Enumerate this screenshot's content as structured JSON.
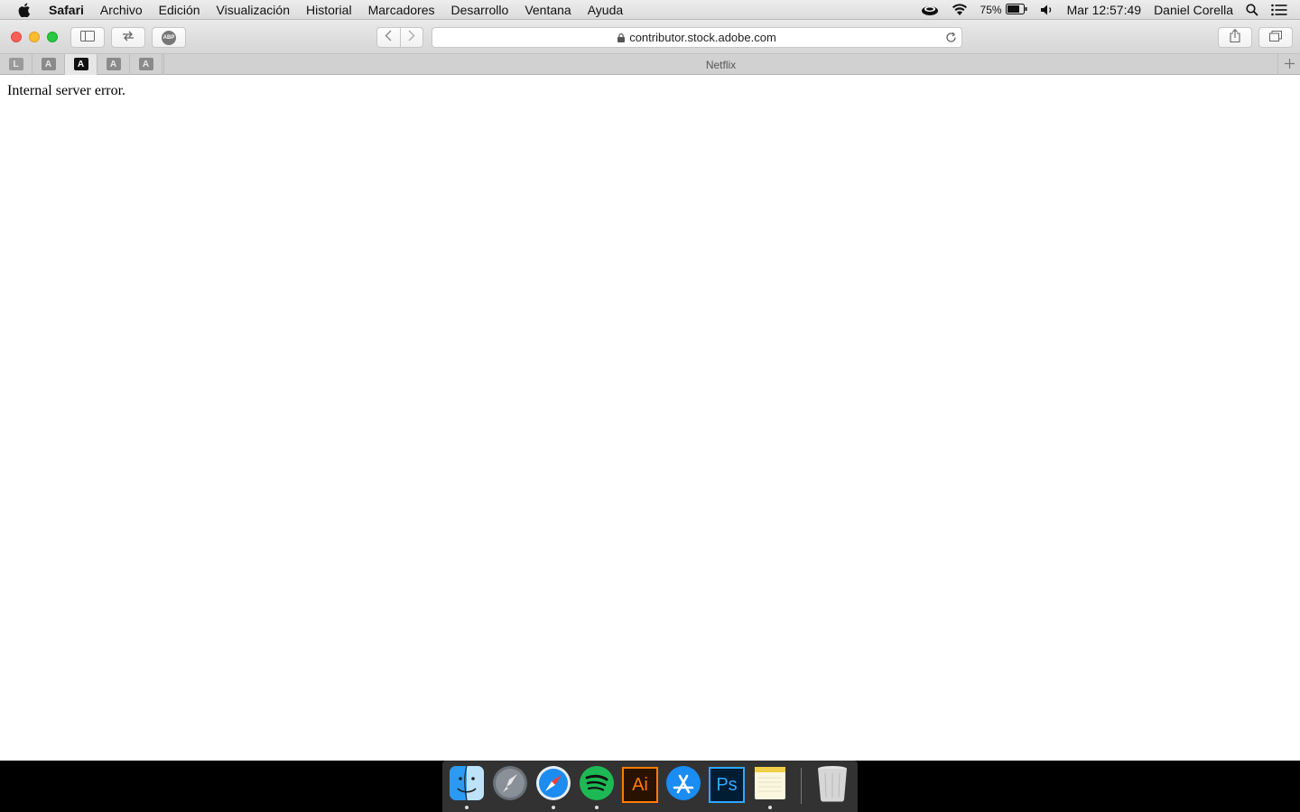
{
  "menubar": {
    "apple_icon": "apple-icon",
    "items": [
      "Safari",
      "Archivo",
      "Edición",
      "Visualización",
      "Historial",
      "Marcadores",
      "Desarrollo",
      "Ventana",
      "Ayuda"
    ],
    "status": {
      "battery_percent": "75%",
      "clock": "Mar 12:57:49",
      "user": "Daniel Corella"
    }
  },
  "toolbar": {
    "url": "contributor.stock.adobe.com",
    "adblock_label": "ABP"
  },
  "tabs": {
    "pinned": [
      {
        "letter": "L",
        "active": false
      },
      {
        "letter": "A",
        "active": false
      },
      {
        "letter": "A",
        "active": true
      },
      {
        "letter": "A",
        "active": false
      },
      {
        "letter": "A",
        "active": false
      }
    ],
    "current": "Netflix"
  },
  "page": {
    "message": "Internal server error."
  },
  "dock": {
    "apps": [
      {
        "name": "finder",
        "running": true,
        "label": ""
      },
      {
        "name": "launchpad",
        "running": false,
        "label": ""
      },
      {
        "name": "safari",
        "running": true,
        "label": ""
      },
      {
        "name": "spotify",
        "running": true,
        "label": ""
      },
      {
        "name": "illustrator",
        "running": false,
        "label": "Ai"
      },
      {
        "name": "app-store",
        "running": false,
        "label": ""
      },
      {
        "name": "photoshop",
        "running": false,
        "label": "Ps"
      },
      {
        "name": "notes",
        "running": true,
        "label": ""
      },
      {
        "name": "trash",
        "running": false,
        "label": ""
      }
    ]
  }
}
